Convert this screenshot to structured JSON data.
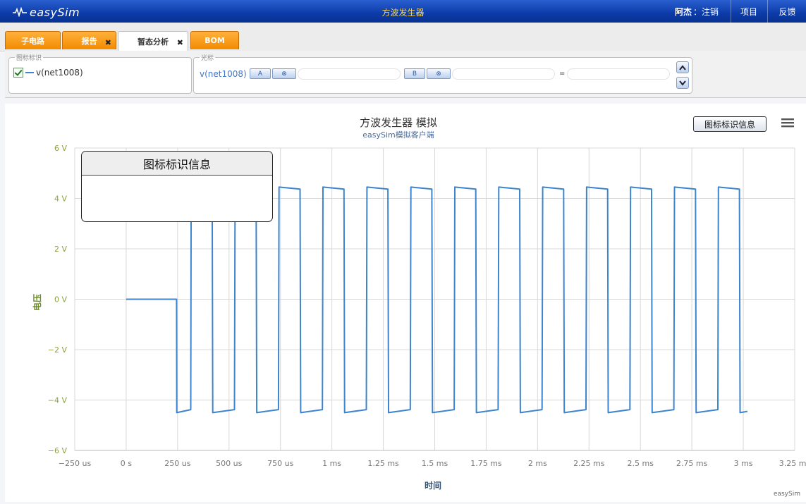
{
  "app": {
    "logo_text": "easySim",
    "title": "方波发生器",
    "user": "阿杰",
    "logout": "：注销",
    "projects": "项目",
    "feedback": "反馈"
  },
  "tabs": [
    {
      "label": "子电路",
      "closable": false,
      "active": false
    },
    {
      "label": "报告",
      "closable": true,
      "active": false
    },
    {
      "label": "暂态分析",
      "closable": true,
      "active": true
    },
    {
      "label": "BOM",
      "closable": false,
      "active": false
    }
  ],
  "close_glyph": "✖",
  "legend_panel": {
    "title": "图标标识",
    "items": [
      {
        "label": "v(net1008)",
        "checked": true,
        "color": "#3d84d0"
      }
    ]
  },
  "cursor_panel": {
    "title": "光标",
    "signal": "v(net1008)",
    "btn_a": "A",
    "btn_b": "B",
    "clear_glyph": "⊗",
    "equals": "=",
    "value_a": "",
    "value_b": "",
    "value_diff": ""
  },
  "chart_toolbar": {
    "info_button": "图标标识信息",
    "menu_icon": "hamburger-menu-icon"
  },
  "info_panel": {
    "title": "图标标识信息",
    "body": ""
  },
  "credit": "easySim",
  "chart_data": {
    "type": "line",
    "title": "方波发生器 模拟",
    "subtitle": "easySim模拟客户端",
    "xlabel": "时间",
    "ylabel": "电压",
    "xlim": [
      -250,
      3250
    ],
    "ylim": [
      -6,
      6
    ],
    "x_ticks": [
      "−250 us",
      "0 s",
      "250 us",
      "500 us",
      "750 us",
      "1 ms",
      "1.25 ms",
      "1.5 ms",
      "1.75 ms",
      "2 ms",
      "2.25 ms",
      "2.5 ms",
      "2.75 ms",
      "3 ms",
      "3.25 ms"
    ],
    "y_ticks": [
      "6 V",
      "4 V",
      "2 V",
      "0 V",
      "−2 V",
      "−4 V",
      "−6 V"
    ],
    "grid": true,
    "series": [
      {
        "name": "v(net1008)",
        "color": "#3d84d0",
        "x_unit": "us",
        "y_unit": "V",
        "start": {
          "x": 0,
          "y": 0
        },
        "oscillation_start_us": 245,
        "first_rise_us": 316,
        "period_us": 213.6,
        "high_width_us": 105,
        "end_us": 3020,
        "high_level": 4.45,
        "low_level": -4.5
      }
    ]
  }
}
